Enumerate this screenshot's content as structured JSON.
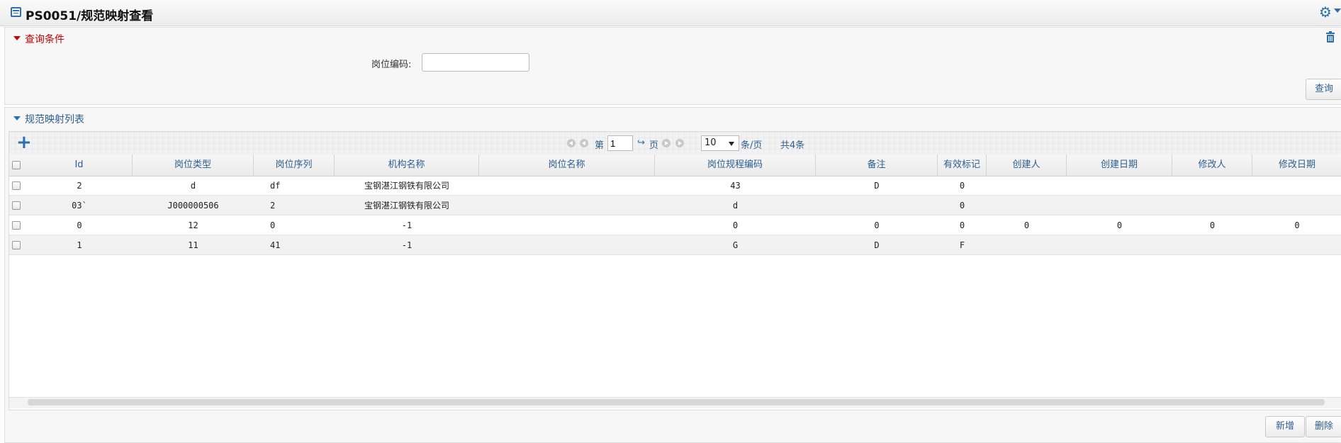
{
  "header": {
    "title": "PS0051/规范映射查看"
  },
  "query": {
    "section_title": "查询条件",
    "field_label": "岗位编码:",
    "field_value": "",
    "query_button": "查询"
  },
  "list": {
    "section_title": "规范映射列表",
    "pager": {
      "page_prefix": "第",
      "page_value": "1",
      "page_suffix": "页",
      "page_size": "10",
      "per_page_label": "条/页",
      "total_label": "共4条"
    },
    "columns": [
      "Id",
      "岗位类型",
      "岗位序列",
      "机构名称",
      "岗位名称",
      "岗位规程编码",
      "备注",
      "有效标记",
      "创建人",
      "创建日期",
      "修改人",
      "修改日期"
    ],
    "rows": [
      [
        "2",
        "d",
        "df",
        "宝钢湛江钢铁有限公司",
        "",
        "43",
        "D",
        "0",
        "",
        "",
        "",
        ""
      ],
      [
        "03`",
        "J000000506",
        "2",
        "宝钢湛江钢铁有限公司",
        "",
        "d",
        "",
        "0",
        "",
        "",
        "",
        ""
      ],
      [
        "0",
        "12",
        "0",
        "-1",
        "",
        "0",
        "0",
        "0",
        "0",
        "0",
        "0",
        "0"
      ],
      [
        "1",
        "11",
        "41",
        "-1",
        "",
        "G",
        "D",
        "F",
        "",
        "",
        "",
        ""
      ]
    ],
    "add_button": "新增",
    "delete_button": "删除"
  },
  "icons": {
    "title": "window-icon",
    "settings": "gear-icon",
    "delete_all": "trash-icon",
    "add_row": "plus-icon"
  },
  "colors": {
    "accent": "#2c6fb0",
    "section_red": "#cc0000"
  }
}
